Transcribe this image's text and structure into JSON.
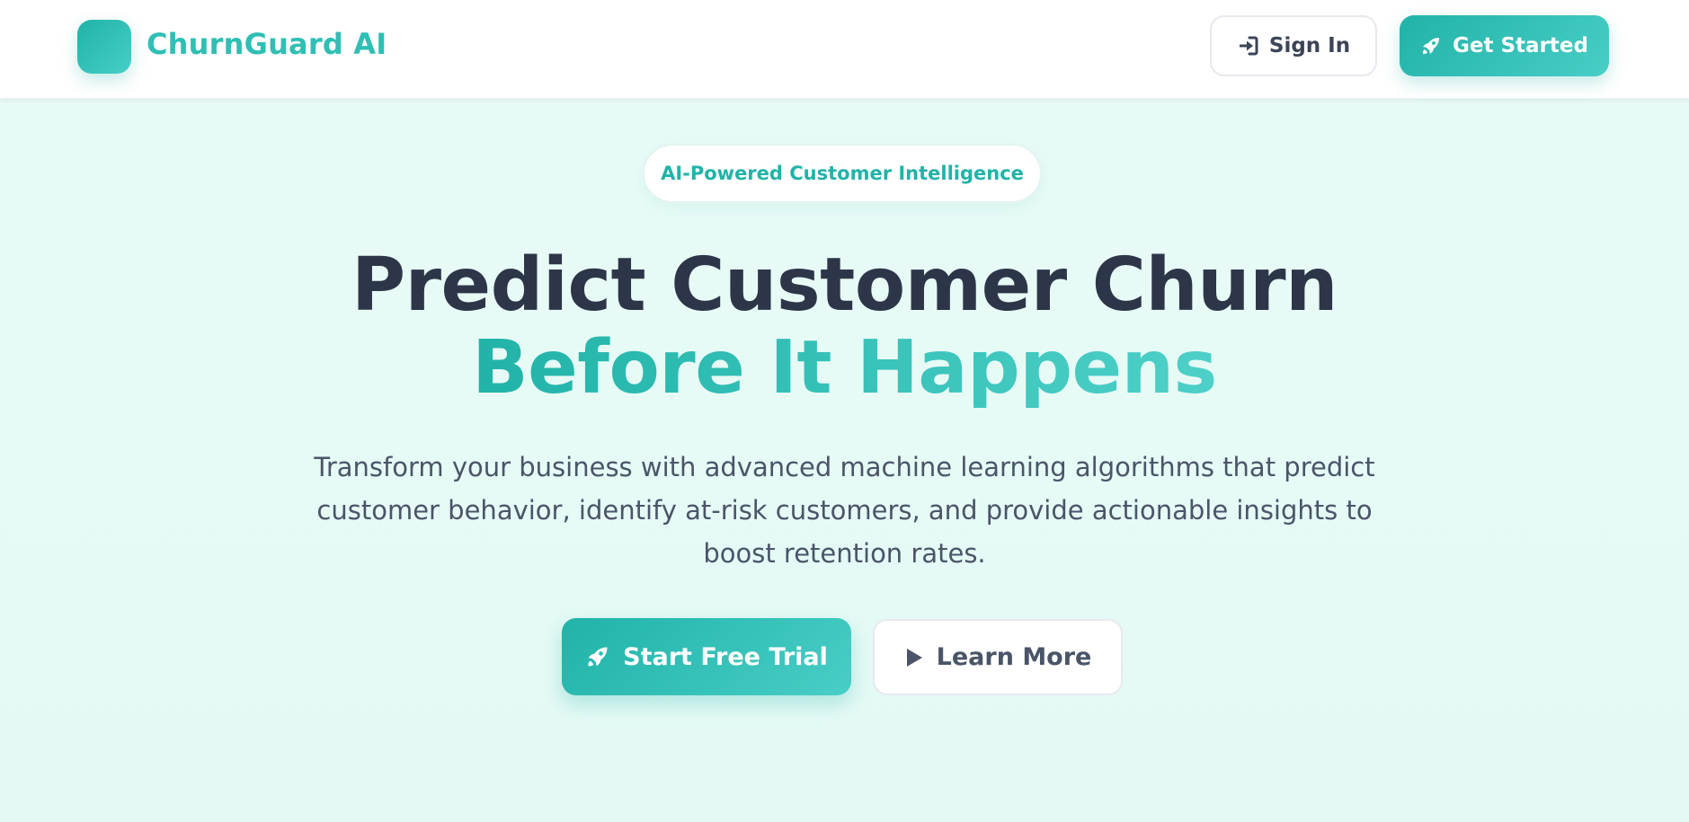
{
  "brand": {
    "name": "ChurnGuard AI",
    "accent_color": "#21b3a8",
    "accent_light": "#48cec6"
  },
  "header": {
    "sign_in_label": "Sign In",
    "sign_in_icon": "sign-in-icon",
    "get_started_label": "Get Started",
    "get_started_icon": "rocket-icon"
  },
  "hero": {
    "badge": "AI-Powered Customer Intelligence",
    "headline_line1": "Predict Customer Churn",
    "headline_line2": "Before It Happens",
    "subtitle": "Transform your business with advanced machine learning algorithms that predict customer behavior, identify at-risk customers, and provide actionable insights to boost retention rates.",
    "primary_cta_label": "Start Free Trial",
    "primary_cta_icon": "rocket-icon",
    "secondary_cta_label": "Learn More",
    "secondary_cta_icon": "play-icon"
  }
}
